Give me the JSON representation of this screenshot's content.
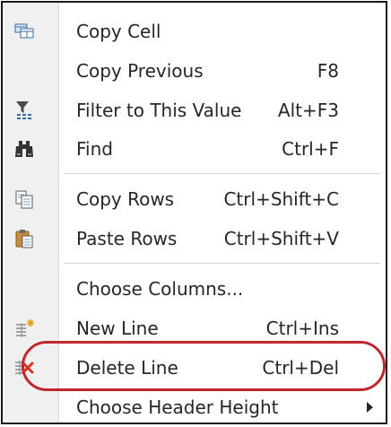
{
  "menu": {
    "items": [
      {
        "label": "Copy Cell",
        "shortcut": "",
        "icon": "copy-cell-icon"
      },
      {
        "label": "Copy Previous",
        "shortcut": "F8",
        "icon": ""
      },
      {
        "label": "Filter to This Value",
        "shortcut": "Alt+F3",
        "icon": "filter-icon"
      },
      {
        "label": "Find",
        "shortcut": "Ctrl+F",
        "icon": "binoculars-icon"
      },
      {
        "label": "Copy Rows",
        "shortcut": "Ctrl+Shift+C",
        "icon": "copy-rows-icon"
      },
      {
        "label": "Paste Rows",
        "shortcut": "Ctrl+Shift+V",
        "icon": "paste-icon"
      },
      {
        "label": "Choose Columns...",
        "shortcut": "",
        "icon": ""
      },
      {
        "label": "New Line",
        "shortcut": "Ctrl+Ins",
        "icon": "new-line-icon"
      },
      {
        "label": "Delete Line",
        "shortcut": "Ctrl+Del",
        "icon": "delete-line-icon"
      },
      {
        "label": "Choose Header Height",
        "shortcut": "",
        "icon": "",
        "submenu": true
      }
    ]
  },
  "colors": {
    "highlight_ring": "#c0282d",
    "gutter": "#f0f0f0",
    "border": "#1a1a1a"
  }
}
